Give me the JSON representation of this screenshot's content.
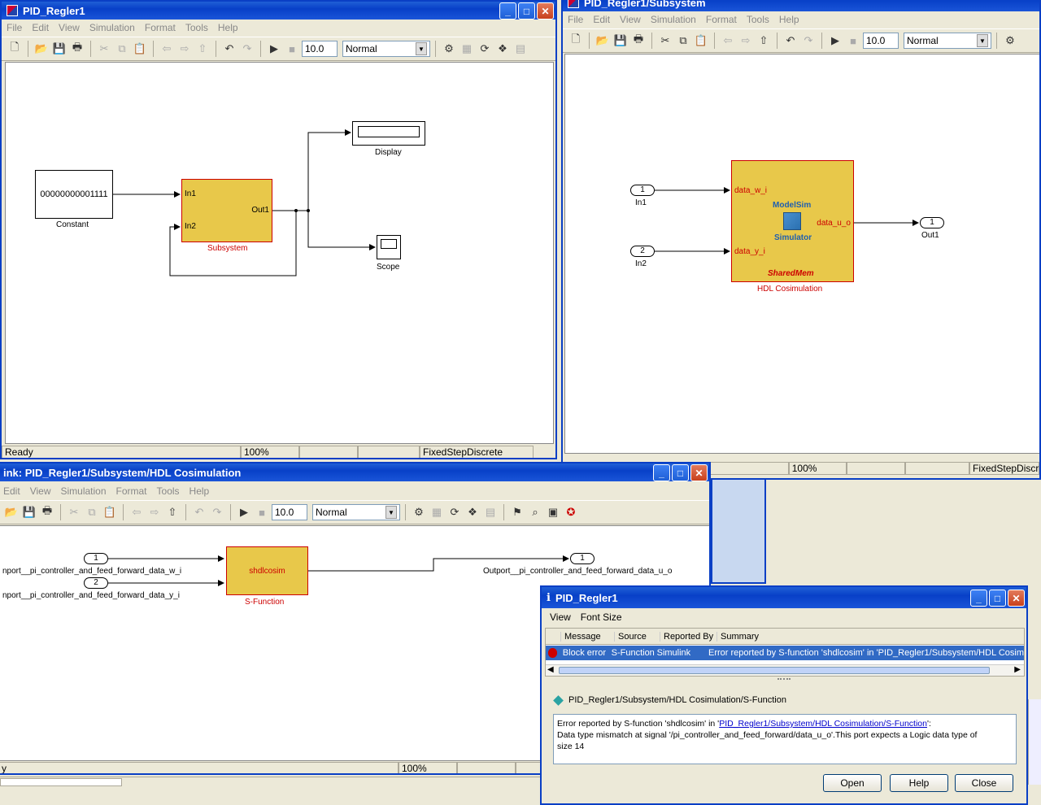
{
  "win1": {
    "title": "PID_Regler1",
    "menu": [
      "File",
      "Edit",
      "View",
      "Simulation",
      "Format",
      "Tools",
      "Help"
    ],
    "stop_time": "10.0",
    "mode": "Normal",
    "blocks": {
      "constant_value": "00000000001111",
      "constant_label": "Constant",
      "subsystem_in1": "In1",
      "subsystem_in2": "In2",
      "subsystem_out1": "Out1",
      "subsystem_label": "Subsystem",
      "display_label": "Display",
      "scope_label": "Scope"
    },
    "status": {
      "ready": "Ready",
      "zoom": "100%",
      "solver": "FixedStepDiscrete"
    }
  },
  "win2": {
    "title": "PID_Regler1/Subsystem",
    "menu": [
      "File",
      "Edit",
      "View",
      "Simulation",
      "Format",
      "Tools",
      "Help"
    ],
    "stop_time": "10.0",
    "mode": "Normal",
    "blocks": {
      "in1_num": "1",
      "in1_label": "In1",
      "in2_num": "2",
      "in2_label": "In2",
      "out1_num": "1",
      "out1_label": "Out1",
      "port_w": "data_w_i",
      "port_y": "data_y_i",
      "port_u": "data_u_o",
      "modelsim": "ModelSim",
      "simulator": "Simulator",
      "sharedmem": "SharedMem",
      "cosim_label": "HDL Cosimulation"
    },
    "status": {
      "zoom": "100%",
      "solver": "FixedStepDiscrete"
    }
  },
  "win3": {
    "title": "ink: PID_Regler1/Subsystem/HDL Cosimulation",
    "menu": [
      "Edit",
      "View",
      "Simulation",
      "Format",
      "Tools",
      "Help"
    ],
    "stop_time": "10.0",
    "mode": "Normal",
    "blocks": {
      "in1_num": "1",
      "in1_label": "nport__pi_controller_and_feed_forward_data_w_i",
      "in2_num": "2",
      "in2_label": "nport__pi_controller_and_feed_forward_data_y_i",
      "sfun_name": "shdlcosim",
      "sfun_label": "S-Function",
      "out1_num": "1",
      "out1_label": "Outport__pi_controller_and_feed_forward_data_u_o"
    },
    "status": {
      "ready": "y",
      "zoom": "100%"
    }
  },
  "dialog": {
    "title": "PID_Regler1",
    "menu": [
      "View",
      "Font Size"
    ],
    "columns": [
      "Message",
      "Source",
      "Reported By",
      "Summary"
    ],
    "row": {
      "message": "Block error",
      "source": "S-Function",
      "reported_by": "Simulink",
      "summary": "Error reported by S-function 'shdlcosim' in 'PID_Regler1/Subsystem/HDL Cosim"
    },
    "path": "PID_Regler1/Subsystem/HDL Cosimulation/S-Function",
    "detail_prefix": "Error reported by S-function 'shdlcosim' in '",
    "detail_link": "PID_Regler1/Subsystem/HDL Cosimulation/S-Function",
    "detail_suffix": "':",
    "detail_line2": "Data type mismatch at signal '/pi_controller_and_feed_forward/data_u_o'.This port expects a Logic data type of",
    "detail_line3": "size 14",
    "buttons": {
      "open": "Open",
      "help": "Help",
      "close": "Close"
    }
  }
}
